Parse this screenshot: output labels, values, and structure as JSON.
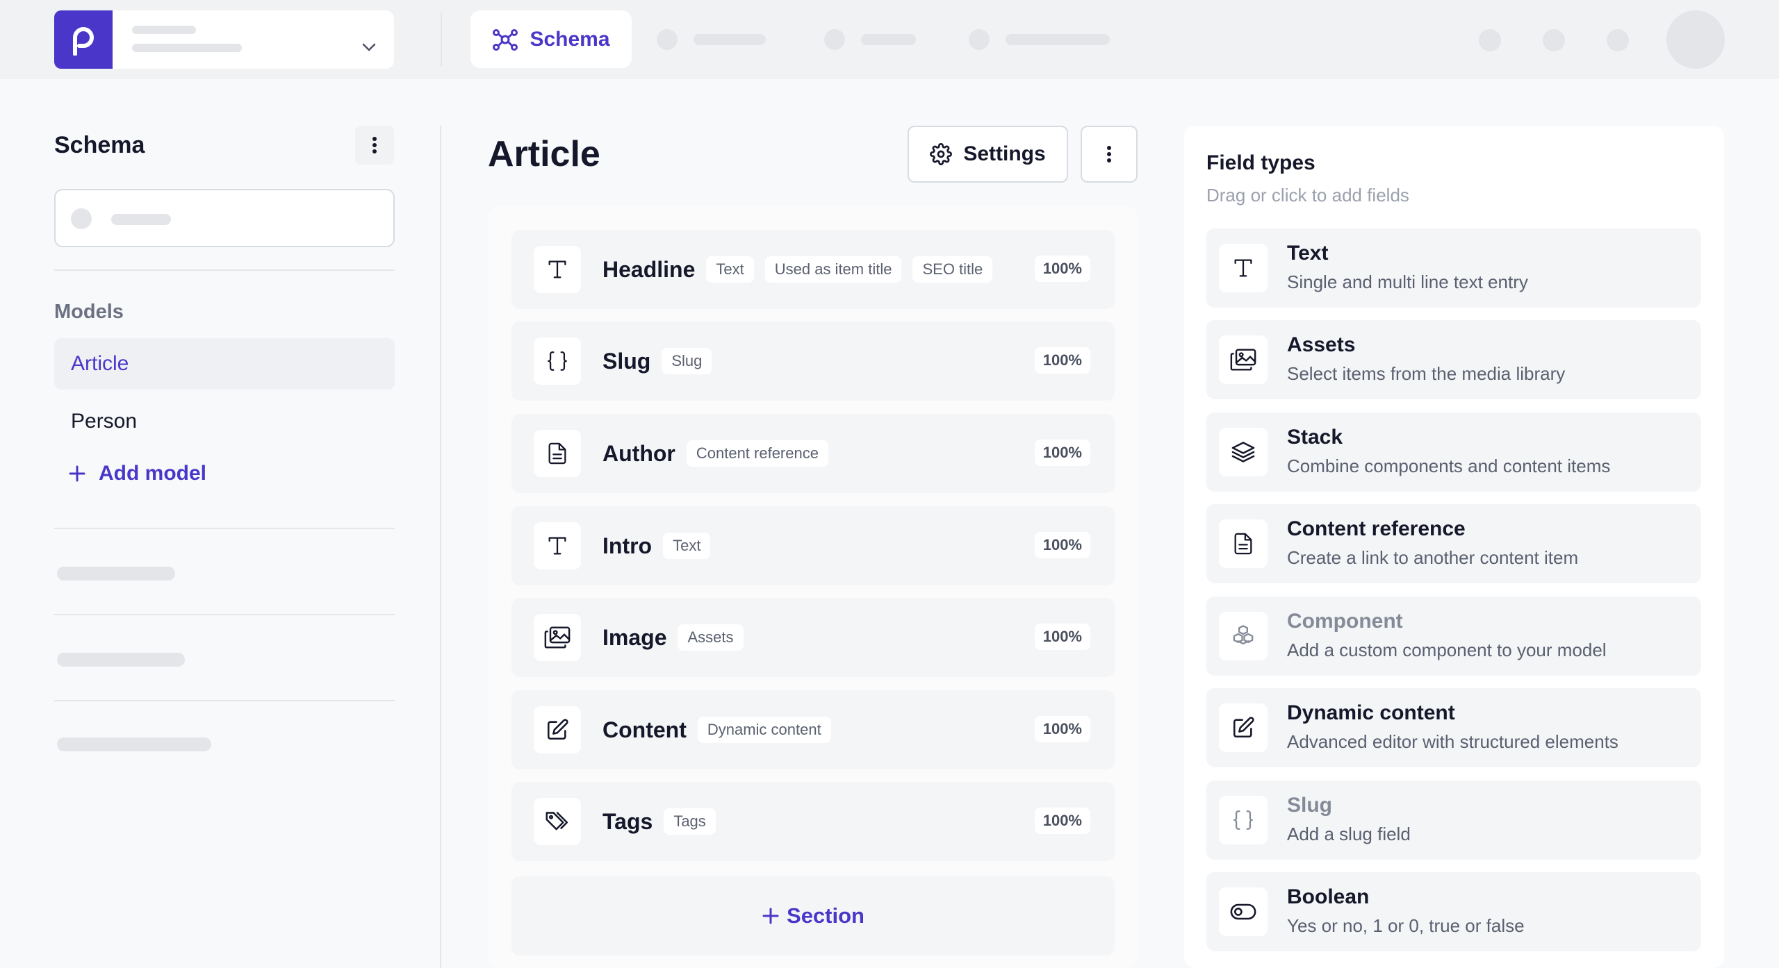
{
  "header": {
    "active_tab": "Schema"
  },
  "sidebar": {
    "title": "Schema",
    "models_label": "Models",
    "models": [
      {
        "label": "Article",
        "active": true
      },
      {
        "label": "Person",
        "active": false
      }
    ],
    "add_model_label": "Add model"
  },
  "main": {
    "title": "Article",
    "settings_label": "Settings",
    "fields": [
      {
        "name": "Headline",
        "tags": [
          "Text",
          "Used as item title",
          "SEO title"
        ],
        "percent": "100%",
        "icon": "text-icon"
      },
      {
        "name": "Slug",
        "tags": [
          "Slug"
        ],
        "percent": "100%",
        "icon": "braces-icon"
      },
      {
        "name": "Author",
        "tags": [
          "Content reference"
        ],
        "percent": "100%",
        "icon": "document-icon"
      },
      {
        "name": "Intro",
        "tags": [
          "Text"
        ],
        "percent": "100%",
        "icon": "text-icon"
      },
      {
        "name": "Image",
        "tags": [
          "Assets"
        ],
        "percent": "100%",
        "icon": "images-icon"
      },
      {
        "name": "Content",
        "tags": [
          "Dynamic content"
        ],
        "percent": "100%",
        "icon": "edit-icon"
      },
      {
        "name": "Tags",
        "tags": [
          "Tags"
        ],
        "percent": "100%",
        "icon": "tag-icon"
      }
    ],
    "add_section_label": "Section"
  },
  "field_types": {
    "title": "Field types",
    "subtitle": "Drag or click to add fields",
    "items": [
      {
        "name": "Text",
        "description": "Single and multi line text entry",
        "icon": "text-icon"
      },
      {
        "name": "Assets",
        "description": "Select items from the media library",
        "icon": "images-icon"
      },
      {
        "name": "Stack",
        "description": "Combine components and content items",
        "icon": "layers-icon"
      },
      {
        "name": "Content reference",
        "description": "Create a link to another content item",
        "icon": "document-icon"
      },
      {
        "name": "Component",
        "description": "Add a custom component to your model",
        "icon": "cubes-icon"
      },
      {
        "name": "Dynamic content",
        "description": "Advanced editor with structured elements",
        "icon": "edit-icon"
      },
      {
        "name": "Slug",
        "description": "Add a slug field",
        "icon": "braces-icon"
      },
      {
        "name": "Boolean",
        "description": "Yes or no, 1 or 0, true or false",
        "icon": "toggle-icon"
      }
    ]
  },
  "colors": {
    "accent": "#4a37c9",
    "background": "#f8f9fb",
    "topbar": "#f1f2f4"
  }
}
